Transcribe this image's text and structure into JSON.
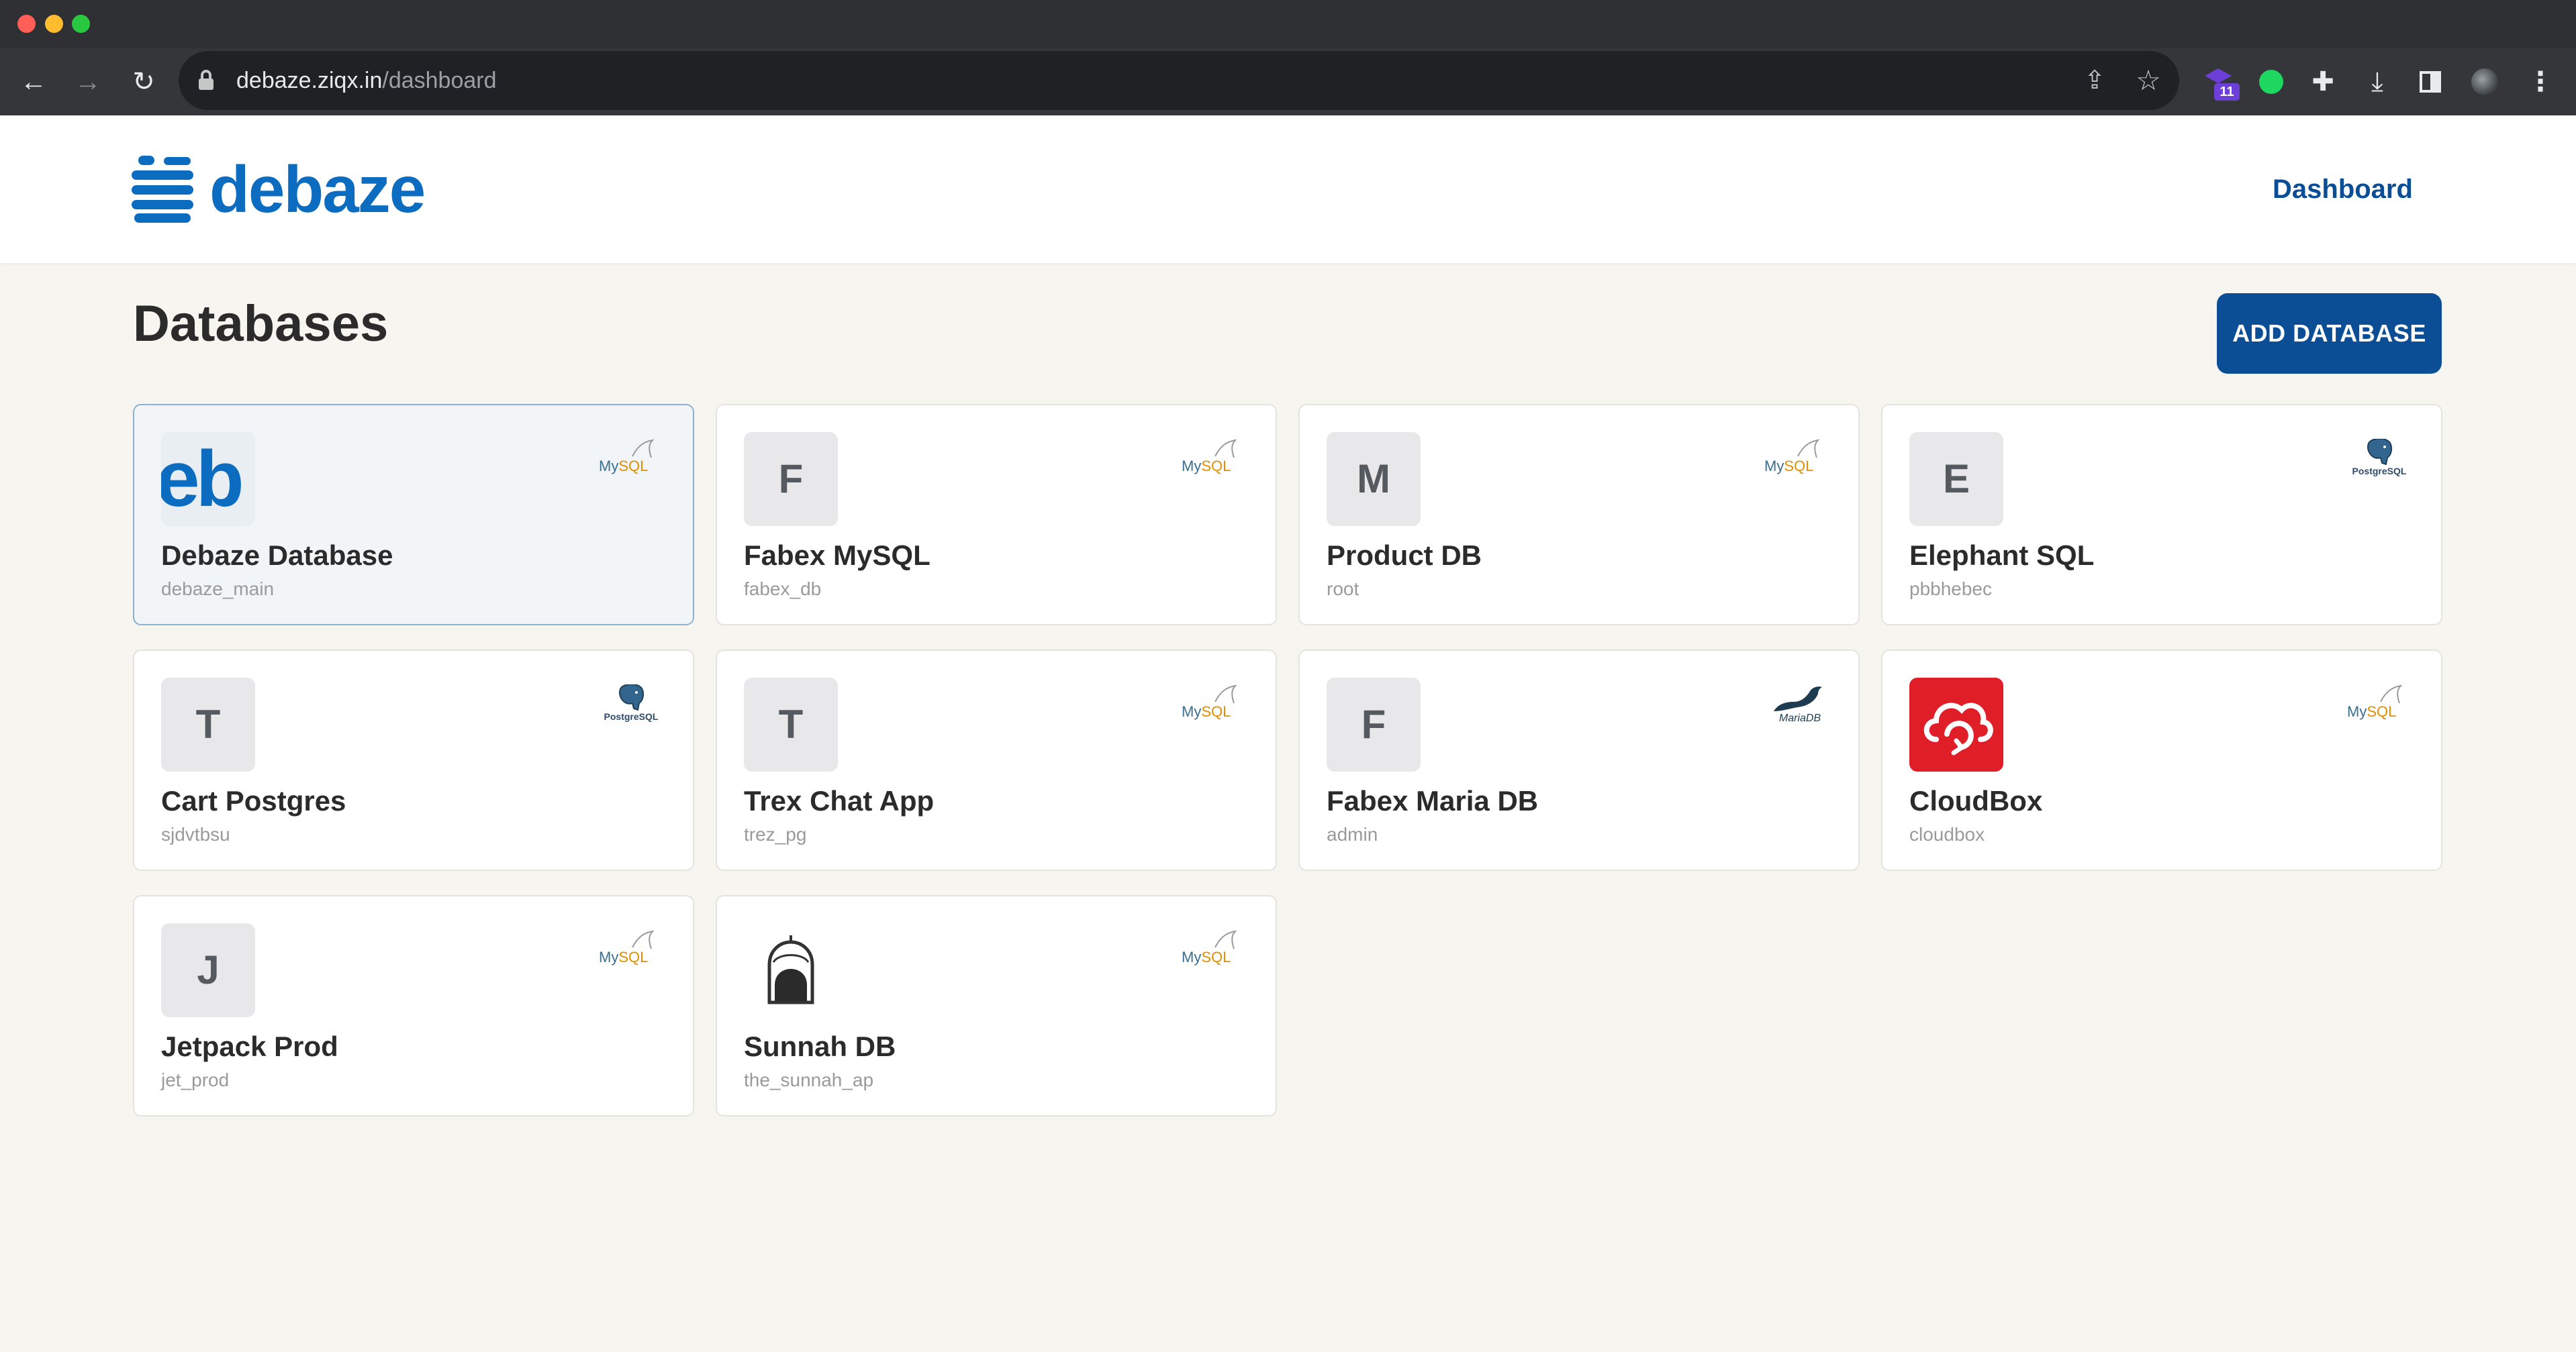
{
  "browser": {
    "url_domain": "debaze.ziqx.in",
    "url_path": "/dashboard",
    "extension_badge": "11"
  },
  "header": {
    "brand": "debaze",
    "nav_dashboard": "Dashboard"
  },
  "page": {
    "title": "Databases",
    "add_button": "ADD DATABASE"
  },
  "databases": [
    {
      "name": "Debaze Database",
      "db": "debaze_main",
      "avatar": "eb",
      "engine": "MySQL",
      "selected": true
    },
    {
      "name": "Fabex MySQL",
      "db": "fabex_db",
      "avatar": "F",
      "engine": "MySQL"
    },
    {
      "name": "Product DB",
      "db": "root",
      "avatar": "M",
      "engine": "MySQL"
    },
    {
      "name": "Elephant SQL",
      "db": "pbbhebec",
      "avatar": "E",
      "engine": "PostgreSQL"
    },
    {
      "name": "Cart Postgres",
      "db": "sjdvtbsu",
      "avatar": "T",
      "engine": "PostgreSQL"
    },
    {
      "name": "Trex Chat App",
      "db": "trez_pg",
      "avatar": "T",
      "engine": "MySQL"
    },
    {
      "name": "Fabex Maria DB",
      "db": "admin",
      "avatar": "F",
      "engine": "MariaDB"
    },
    {
      "name": "CloudBox",
      "db": "cloudbox",
      "avatar": "cloud-logo",
      "engine": "MySQL"
    },
    {
      "name": "Jetpack Prod",
      "db": "jet_prod",
      "avatar": "J",
      "engine": "MySQL"
    },
    {
      "name": "Sunnah DB",
      "db": "the_sunnah_ap",
      "avatar": "dome-logo",
      "engine": "MySQL"
    }
  ],
  "engine_labels": {
    "mysql_my": "My",
    "mysql_sql": "SQL",
    "postgres": "PostgreSQL",
    "maria": "MariaDB"
  },
  "colors": {
    "brand": "#0b6cc0",
    "primary_button": "#0b4e96",
    "background": "#f6f5ef"
  }
}
